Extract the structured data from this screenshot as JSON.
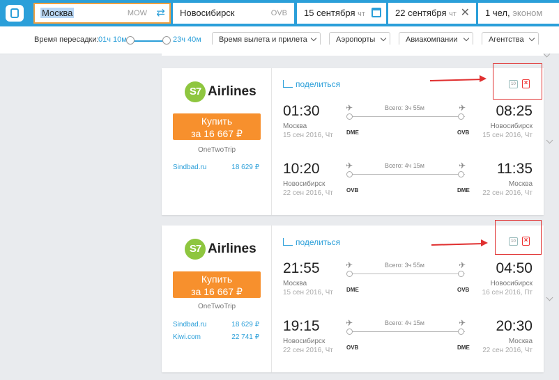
{
  "search": {
    "from_city": "Москва",
    "from_code": "MOW",
    "to_city": "Новосибирск",
    "to_code": "OVB",
    "depart_date": "15 сентября",
    "depart_dow": "чт",
    "return_date": "22 сентября",
    "return_dow": "чт",
    "passengers": "1 чел,",
    "cabin": "эконом"
  },
  "filters": {
    "transfer_label": "Время пересадки:",
    "transfer_min": "01ч 10м",
    "transfer_max": "23ч 40м",
    "dropdowns": [
      "Время вылета и прилета",
      "Аэропорты",
      "Авиакомпании",
      "Агентства"
    ]
  },
  "cards": [
    {
      "airline_logo": "S7",
      "airline_name": "Airlines",
      "buy_label": "Купить",
      "buy_price": "за 16 667 ₽",
      "agency": "OneTwoTrip",
      "offers": [
        {
          "name": "Sindbad.ru",
          "price": "18 629 ₽"
        }
      ],
      "share_label": "поделиться",
      "baggage": "10",
      "legs": [
        {
          "dep_time": "01:30",
          "arr_time": "08:25",
          "dep_city": "Москва",
          "arr_city": "Новосибирск",
          "dep_date": "15 сен 2016, Чт",
          "arr_date": "15 сен 2016, Чт",
          "duration": "Всего: 3ч 55м",
          "dep_ap": "DME",
          "arr_ap": "OVB"
        },
        {
          "dep_time": "10:20",
          "arr_time": "11:35",
          "dep_city": "Новосибирск",
          "arr_city": "Москва",
          "dep_date": "22 сен 2016, Чт",
          "arr_date": "22 сен 2016, Чт",
          "duration": "Всего: 4ч 15м",
          "dep_ap": "OVB",
          "arr_ap": "DME"
        }
      ]
    },
    {
      "airline_logo": "S7",
      "airline_name": "Airlines",
      "buy_label": "Купить",
      "buy_price": "за 16 667 ₽",
      "agency": "OneTwoTrip",
      "offers": [
        {
          "name": "Sindbad.ru",
          "price": "18 629 ₽"
        },
        {
          "name": "Kiwi.com",
          "price": "22 741 ₽"
        }
      ],
      "share_label": "поделиться",
      "baggage": "10",
      "legs": [
        {
          "dep_time": "21:55",
          "arr_time": "04:50",
          "dep_city": "Москва",
          "arr_city": "Новосибирск",
          "dep_date": "15 сен 2016, Чт",
          "arr_date": "16 сен 2016, Пт",
          "duration": "Всего: 3ч 55м",
          "dep_ap": "DME",
          "arr_ap": "OVB"
        },
        {
          "dep_time": "19:15",
          "arr_time": "20:30",
          "dep_city": "Новосибирск",
          "arr_city": "Москва",
          "dep_date": "22 сен 2016, Чт",
          "arr_date": "22 сен 2016, Чт",
          "duration": "Всего: 4ч 15м",
          "dep_ap": "OVB",
          "arr_ap": "DME"
        }
      ]
    }
  ],
  "colors": {
    "brand": "#2b9fd9",
    "buy": "#f7902d",
    "annotation": "#e03030",
    "s7": "#8ec63f"
  }
}
